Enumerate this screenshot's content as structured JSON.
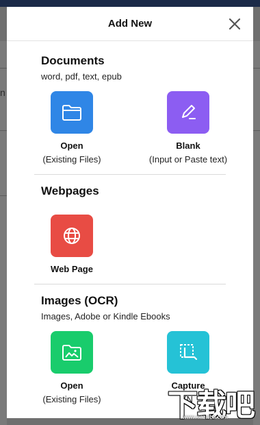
{
  "background": {
    "partial_letter": "n"
  },
  "modal": {
    "title": "Add New",
    "close_icon": "close-icon"
  },
  "sections": {
    "documents": {
      "title": "Documents",
      "subtitle": "word, pdf, text, epub",
      "tiles": [
        {
          "label": "Open",
          "sub": "(Existing Files)",
          "icon": "folder-icon",
          "color": "#2f86e6"
        },
        {
          "label": "Blank",
          "sub": "(Input or Paste text)",
          "icon": "pen-icon",
          "color": "#8c5df2"
        }
      ]
    },
    "webpages": {
      "title": "Webpages",
      "tiles": [
        {
          "label": "Web Page",
          "icon": "globe-icon",
          "color": "#e84c44"
        }
      ]
    },
    "images": {
      "title": "Images (OCR)",
      "subtitle": "Images, Adobe or Kindle Ebooks",
      "tiles": [
        {
          "label": "Open",
          "sub": "(Existing Files)",
          "icon": "image-folder-icon",
          "color": "#19cc6c"
        },
        {
          "label": "Capture",
          "sub": "(N",
          "icon": "crop-icon",
          "color": "#25c2d6"
        }
      ]
    }
  },
  "watermark": {
    "text": "下载吧",
    "url": "www.xiazaiba.com"
  }
}
